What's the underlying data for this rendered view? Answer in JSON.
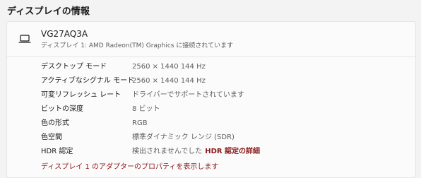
{
  "section_title": "ディスプレイの情報",
  "monitor": {
    "icon": "laptop-icon",
    "name": "VG27AQ3A",
    "subtitle": "ディスプレイ 1: AMD Radeon(TM) Graphics に接続されています"
  },
  "rows": [
    {
      "label": "デスクトップ モード",
      "value": "2560 × 1440 144 Hz"
    },
    {
      "label": "アクティブなシグナル モード",
      "value": "2560 × 1440 144 Hz"
    },
    {
      "label": "可変リフレッシュ レート",
      "value": "ドライバーでサポートされています"
    },
    {
      "label": "ビットの深度",
      "value": "8 ビット"
    },
    {
      "label": "色の形式",
      "value": "RGB"
    },
    {
      "label": "色空間",
      "value": "標準ダイナミック レンジ (SDR)"
    },
    {
      "label": "HDR 認定",
      "value": "検出されませんでした",
      "link": "HDR 認定の詳細"
    }
  ],
  "adapter_link": "ディスプレイ 1 のアダプターのプロパティを表示します",
  "colors": {
    "link": "#8b1a1a",
    "background": "#f3f3f3",
    "card": "#fbfbfb"
  }
}
